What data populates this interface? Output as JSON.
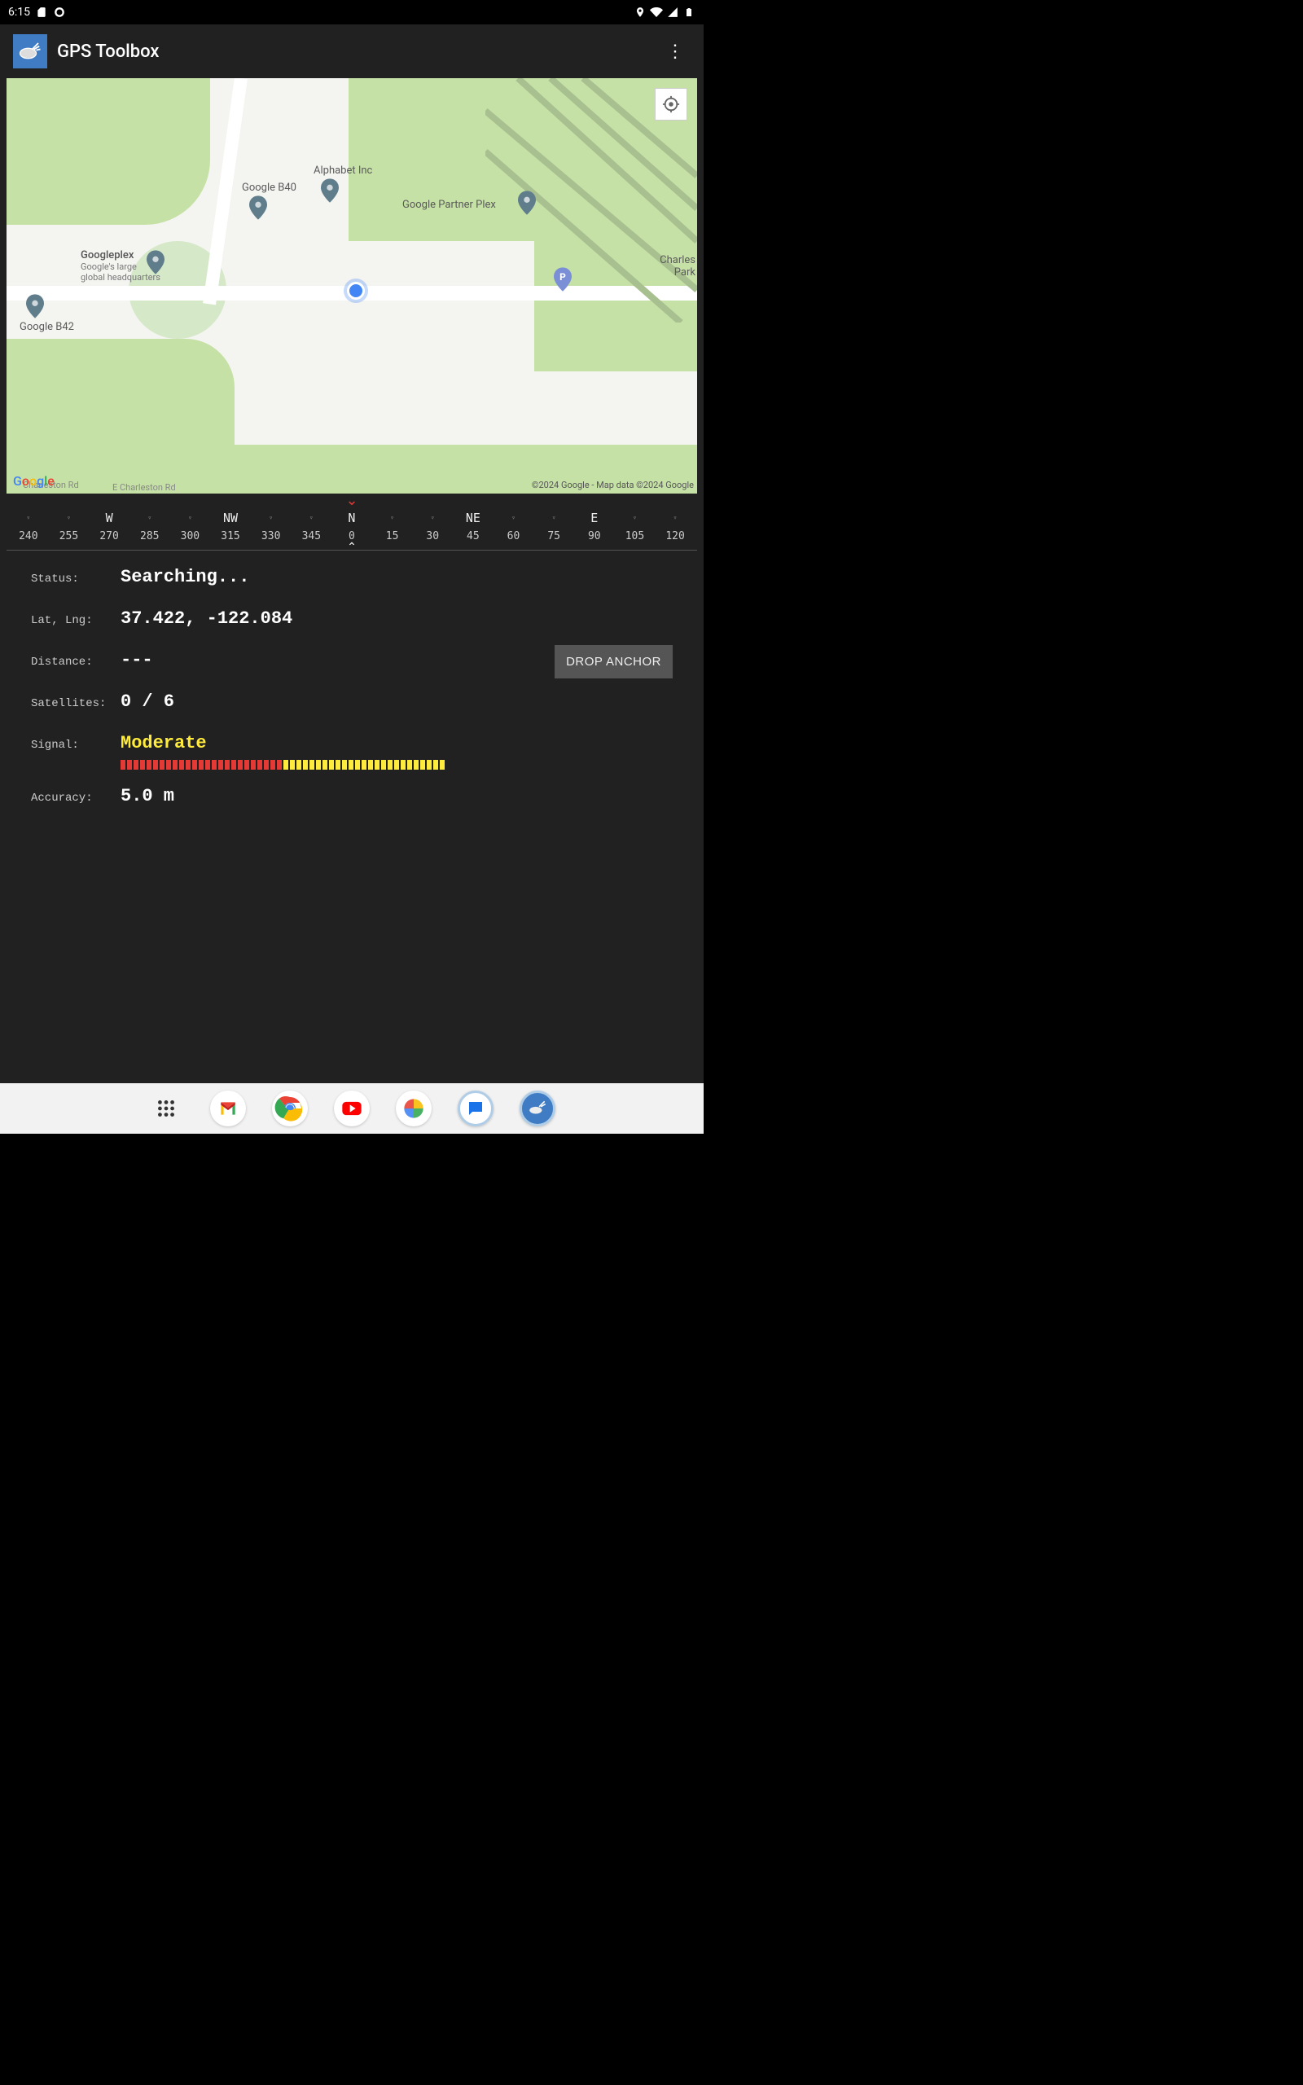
{
  "statusbar": {
    "time": "6:15"
  },
  "appbar": {
    "title": "GPS Toolbox"
  },
  "map": {
    "labels": {
      "googleplex": "Googleplex",
      "googleplex_sub1": "Google's large",
      "googleplex_sub2": "global headquarters",
      "b40": "Google B40",
      "alphabet": "Alphabet Inc",
      "partner": "Google Partner Plex",
      "b42": "Google B42",
      "charles": "Charles",
      "park": "Park",
      "charleston": "Charleston Rd",
      "e_charleston": "E Charleston Rd"
    },
    "copyright": "©2024 Google - Map data ©2024 Google"
  },
  "compass": {
    "dirs": [
      "",
      "",
      "W",
      "",
      "",
      "NW",
      "",
      "",
      "N",
      "",
      "",
      "NE",
      "",
      "",
      "E",
      "",
      ""
    ],
    "degs": [
      "240",
      "255",
      "270",
      "285",
      "300",
      "315",
      "330",
      "345",
      "0",
      "15",
      "30",
      "45",
      "60",
      "75",
      "90",
      "105",
      "120"
    ]
  },
  "data": {
    "status_label": "Status:",
    "status_value": "Searching...",
    "latlng_label": "Lat, Lng:",
    "latlng_value": "37.422, -122.084",
    "distance_label": "Distance:",
    "distance_value": "---",
    "drop_anchor": "DROP ANCHOR",
    "sat_label": "Satellites:",
    "sat_value": "0 / 6",
    "signal_label": "Signal:",
    "signal_value": "Moderate",
    "accuracy_label": "Accuracy:",
    "accuracy_value": "5.0 m"
  }
}
